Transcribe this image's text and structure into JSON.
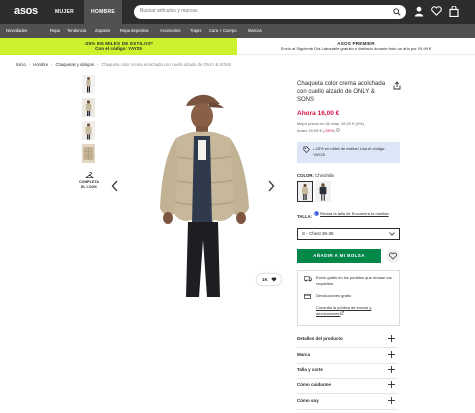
{
  "header": {
    "logo": "asos",
    "tabs": [
      {
        "label": "MUJER"
      },
      {
        "label": "HOMBRE",
        "active": true
      }
    ],
    "search_placeholder": "Buscar artículos y marcas"
  },
  "categories": [
    "Novedades",
    "Ropa",
    "Tendencia",
    "Zapatos",
    "Ropa deportiva",
    "Accesorios",
    "Trajes",
    "Cara + Cuerpo",
    "Marcas"
  ],
  "promo": {
    "left_line1": "-25% EN MILES DE ESTILOS*",
    "left_line2": "Con el código: YAY25",
    "right_line1": "ASOS PREMIER",
    "right_line2": "Envío al Siguiente Día Laborable gratuito e ilimitado durante todo un año por 29,99 €"
  },
  "breadcrumb": {
    "items": [
      "Inicio",
      "Hombre",
      "Chaquetas y abrigos"
    ],
    "current": "Chaqueta color crema acolchada con cuello alzado de ONLY & SONS"
  },
  "gallery": {
    "complete_look_line1": "COMPLETA",
    "complete_look_line2": "EL LOOK",
    "likes_count": "1K"
  },
  "product": {
    "title": "Chaqueta color crema acolchada con cuello alzado de ONLY & SONS",
    "price_now": "Ahora 16,00 €",
    "recent_price": "Mejor precio en 30 días: 16,00 € (0%)",
    "was_price_prefix": "Antes 39,99 € (",
    "was_discount": "-59%",
    "was_suffix": ")",
    "discount_text": "¡-25% en miles de estilos! Usa el código: YAY25",
    "color_label": "COLOR:",
    "color_value": "Chinchilla",
    "size_label": "TALLA:",
    "size_guide": "Revisa la talla de Encuentra tu medida",
    "size_selected": "S - Chest 36-38",
    "add_to_bag": "AÑADIR A MI BOLSA",
    "delivery_text": "Envío gratis en los pedidos que reúnan los requisitos.",
    "returns_text": "Devoluciones gratis",
    "returns_policy": "Consulta la política de envíos y devoluciones"
  },
  "accordion": [
    "Detalles del producto",
    "Marca",
    "Talla y corte",
    "Cómo cuidarme",
    "Cómo soy"
  ],
  "colors": {
    "brand_dark": "#2d2d2d",
    "promo_lime": "#cbf22c",
    "price_red": "#d01345",
    "add_green": "#018849",
    "discount_blue": "#dde6f7"
  }
}
